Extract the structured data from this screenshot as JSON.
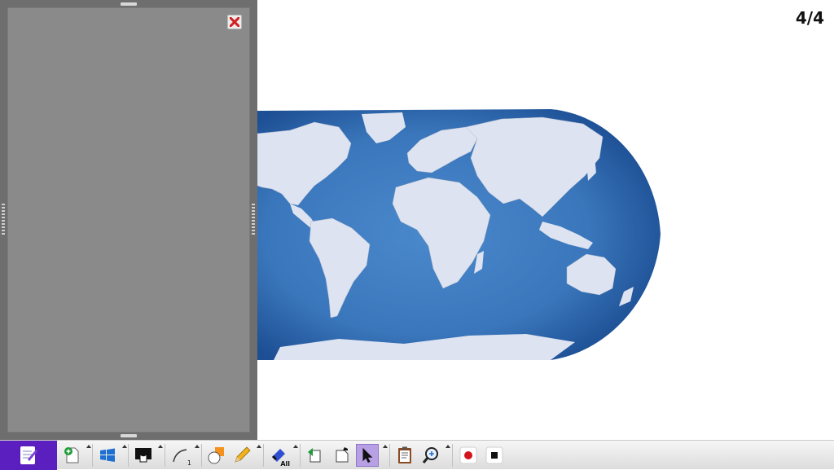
{
  "page_counter": "4/4",
  "side_panel": {
    "close_icon": "close-icon"
  },
  "map": {
    "icon": "world-map-image"
  },
  "toolbar": {
    "eraser_all_label": "All",
    "line_width_label": "1",
    "tools": [
      "notebook-icon",
      "add-page-icon",
      "windows-icon",
      "ink-screen-icon",
      "pen-curve-icon",
      "shapes-icon",
      "pencil-icon",
      "eraser-all-icon",
      "undo-icon",
      "redo-icon",
      "select-pointer-icon",
      "clipboard-icon",
      "zoom-icon",
      "record-icon",
      "stop-icon"
    ]
  },
  "colors": {
    "panel_bg": "#6e6e6e",
    "panel_inner": "#8a8a8a",
    "ocean": "#3b78bd",
    "land": "#dde3f0",
    "app_button": "#5b1fc0",
    "active_tool": "#b7a1e4"
  }
}
